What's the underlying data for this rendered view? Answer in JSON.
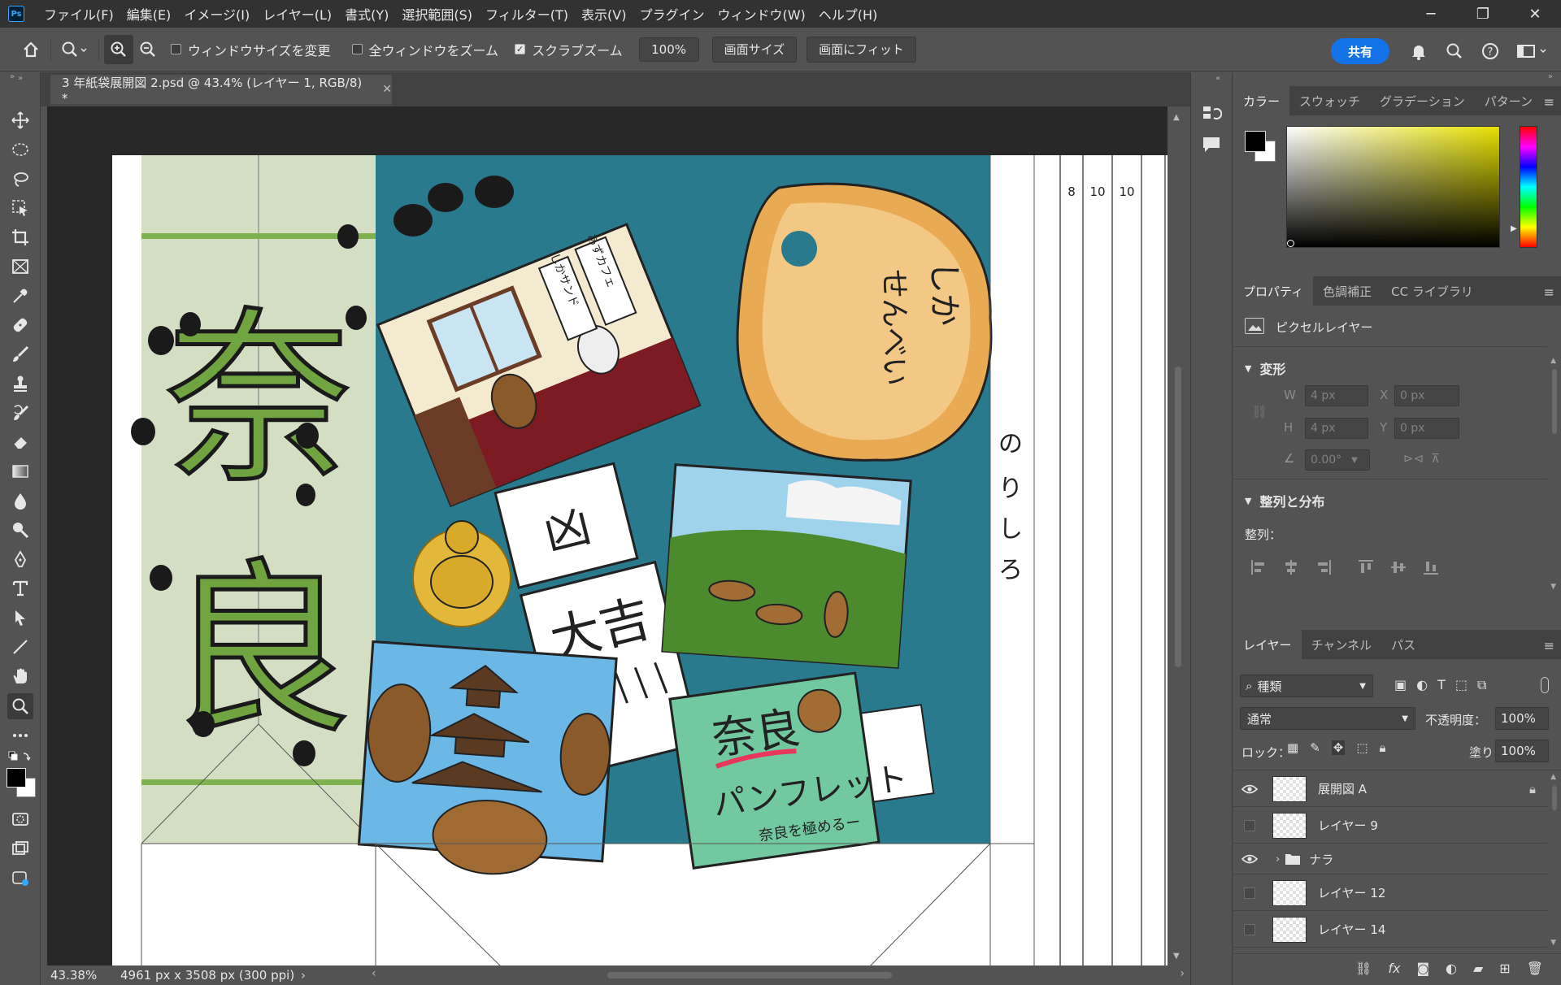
{
  "app": {
    "logo_text": "Ps"
  },
  "menu": [
    "ファイル(F)",
    "編集(E)",
    "イメージ(I)",
    "レイヤー(L)",
    "書式(Y)",
    "選択範囲(S)",
    "フィルター(T)",
    "表示(V)",
    "プラグイン",
    "ウィンドウ(W)",
    "ヘルプ(H)"
  ],
  "options_bar": {
    "resize_windows_label": "ウィンドウサイズを変更",
    "resize_windows_checked": false,
    "zoom_all_label": "全ウィンドウをズーム",
    "zoom_all_checked": false,
    "scrubby_zoom_label": "スクラブズーム",
    "scrubby_zoom_checked": true,
    "zoom_value": "100%",
    "fit_screen_size_label": "画面サイズ",
    "fit_screen_label": "画面にフィット",
    "share_label": "共有"
  },
  "document": {
    "tab_title": "3 年紙袋展開図 2.psd @ 43.4% (レイヤー 1, RGB/8) *",
    "zoom_readout": "43.38%",
    "size_info": "4961 px x 3508 px (300 ppi)",
    "ruler_labels": [
      "8",
      "10",
      "10"
    ],
    "art": {
      "title_kanji": [
        "奈",
        "良"
      ],
      "side_text": [
        "の",
        "り",
        "し",
        "ろ"
      ],
      "cafe_sign": "しかサンド",
      "cafe_sign2": "あずカフェ",
      "senbei_text": [
        "しか",
        "せんべい"
      ],
      "omikuji_top": "凶",
      "omikuji_main": "大吉",
      "pamphlet_title": "奈良",
      "pamphlet_sub": "パンフレット",
      "pamphlet_note": "奈良を極めるー"
    }
  },
  "color_panel": {
    "tabs": [
      "カラー",
      "スウォッチ",
      "グラデーション",
      "パターン"
    ],
    "active_tab": 0,
    "foreground": "#000000",
    "background": "#ffffff"
  },
  "properties_panel": {
    "tabs": [
      "プロパティ",
      "色調補正",
      "CC ライブラリ"
    ],
    "active_tab": 0,
    "layer_type": "ピクセルレイヤー",
    "transform_title": "変形",
    "w_label": "W",
    "w_value": "4 px",
    "h_label": "H",
    "h_value": "4 px",
    "x_label": "X",
    "x_value": "0 px",
    "y_label": "Y",
    "y_value": "0 px",
    "angle_value": "0.00°",
    "align_title": "整列と分布",
    "align_label": "整列："
  },
  "layers_panel": {
    "tabs": [
      "レイヤー",
      "チャンネル",
      "パス"
    ],
    "active_tab": 0,
    "filter_label": "種類",
    "blend_mode": "通常",
    "opacity_label": "不透明度：",
    "opacity_value": "100%",
    "lock_label": "ロック：",
    "fill_label": "塗り：",
    "fill_value": "100%",
    "layers": [
      {
        "name": "展開図 A",
        "visible": true,
        "locked": true,
        "group": false
      },
      {
        "name": "レイヤー 9",
        "visible": false,
        "locked": false,
        "group": false
      },
      {
        "name": "ナラ",
        "visible": true,
        "locked": false,
        "group": true
      },
      {
        "name": "レイヤー 12",
        "visible": false,
        "locked": false,
        "group": false
      },
      {
        "name": "レイヤー 14",
        "visible": false,
        "locked": false,
        "group": false
      }
    ]
  }
}
